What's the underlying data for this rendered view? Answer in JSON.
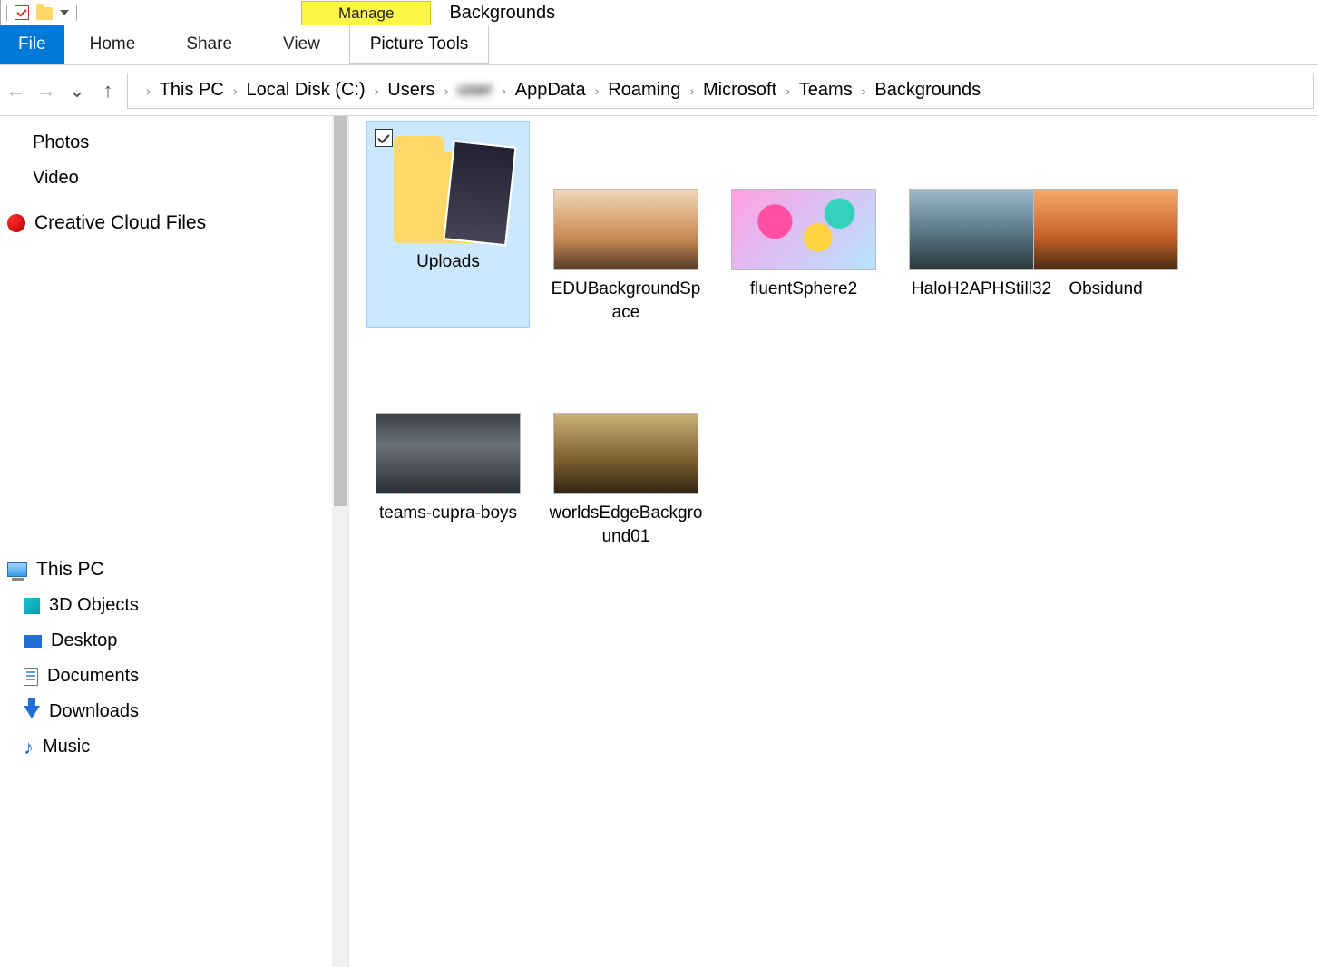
{
  "window": {
    "title": "Backgrounds"
  },
  "ribbon": {
    "file": "File",
    "tabs": [
      "Home",
      "Share",
      "View"
    ],
    "context_group": "Manage",
    "context_tab": "Picture Tools"
  },
  "breadcrumb": [
    "This PC",
    "Local Disk (C:)",
    "Users",
    "",
    "AppData",
    "Roaming",
    "Microsoft",
    "Teams",
    "Backgrounds"
  ],
  "sidebar": {
    "quick": [
      {
        "label": "Photos",
        "icon": "folder"
      },
      {
        "label": "Video",
        "icon": "folder"
      }
    ],
    "creative_cloud": "Creative Cloud Files",
    "this_pc": "This PC",
    "this_pc_children": [
      {
        "label": "3D Objects",
        "icon": "cube"
      },
      {
        "label": "Desktop",
        "icon": "desktop"
      },
      {
        "label": "Documents",
        "icon": "doc"
      },
      {
        "label": "Downloads",
        "icon": "download"
      },
      {
        "label": "Music",
        "icon": "music"
      }
    ]
  },
  "items": [
    {
      "name": "Uploads",
      "type": "folder",
      "selected": true,
      "checked": true
    },
    {
      "name": "EDUBackgroundSpace",
      "type": "image",
      "thumb": "t1"
    },
    {
      "name": "fluentSphere2",
      "type": "image",
      "thumb": "t2"
    },
    {
      "name": "HaloH2APHStill32",
      "type": "image",
      "thumb": "t3"
    },
    {
      "name": "Obsidund",
      "type": "image",
      "thumb": "t4",
      "clipped": true
    },
    {
      "name": "teams-cupra-boys",
      "type": "image",
      "thumb": "t5"
    },
    {
      "name": "worldsEdgeBackground01",
      "type": "image",
      "thumb": "t6"
    }
  ]
}
